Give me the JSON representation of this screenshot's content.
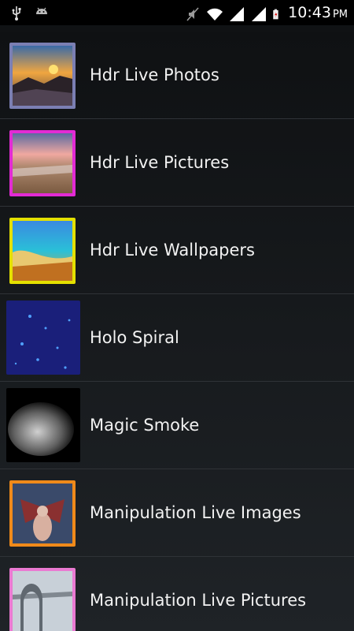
{
  "status_bar": {
    "time": "10:43",
    "ampm": "PM",
    "icons": [
      "usb-icon",
      "android-icon",
      "mute-icon",
      "wifi-icon",
      "signal-1-icon",
      "signal-2-icon",
      "battery-charging-icon"
    ]
  },
  "colors": {
    "frame_purple": "#7b7fb3",
    "frame_magenta": "#e22bd4",
    "frame_yellow": "#e4e000",
    "frame_orange": "#f08a1a",
    "frame_pink": "#ea7ad2"
  },
  "list": {
    "items": [
      {
        "label": "Hdr Live Photos",
        "thumb": "sunset-rocks-thumbnail"
      },
      {
        "label": "Hdr Live Pictures",
        "thumb": "beach-sunset-thumbnail"
      },
      {
        "label": "Hdr Live Wallpapers",
        "thumb": "tropical-beach-thumbnail"
      },
      {
        "label": "Holo Spiral",
        "thumb": "blue-particles-thumbnail"
      },
      {
        "label": "Magic Smoke",
        "thumb": "smoke-thumbnail"
      },
      {
        "label": "Manipulation Live Images",
        "thumb": "fantasy-figure-thumbnail"
      },
      {
        "label": "Manipulation Live Pictures",
        "thumb": "bridge-thumbnail"
      }
    ]
  }
}
